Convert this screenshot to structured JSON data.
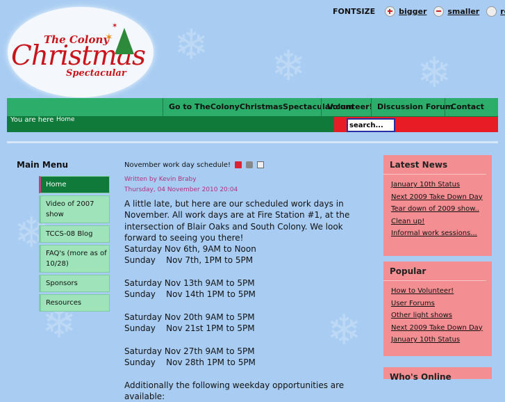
{
  "logo": {
    "line1": "The Colony",
    "line2": "Christmas",
    "line3": "Spectacular"
  },
  "fontsize": {
    "label": "FONTSIZE",
    "bigger": "bigger",
    "smaller": "smaller",
    "reset": "reset"
  },
  "topnav": {
    "items": [
      "Go to TheColonyChristmasSpectacular.com",
      "Volunteer!",
      "Discussion Forum",
      "Contact Us!"
    ]
  },
  "breadcrumb": {
    "label": "You are here",
    "home": "Home"
  },
  "search": {
    "placeholder": "search..."
  },
  "main_menu": {
    "title": "Main Menu",
    "items": [
      "Home",
      "Video of 2007 show",
      "TCCS-08 Blog",
      "FAQ's (more as of 10/28)",
      "Sponsors",
      "Resources"
    ]
  },
  "article": {
    "title": "November work day schedule!",
    "author": "Written by Kevin Braby",
    "date": "Thursday, 04 November 2010 20:04",
    "intro": "A little late, but here are our scheduled work days in November. All work days are at Fire Station #1, at the intersection of Blair Oaks and South Colony. We look forward to seeing you there!",
    "schedule": [
      [
        "Saturday Nov 6th, 9AM to Noon",
        "Sunday    Nov 7th, 1PM to 5PM"
      ],
      [
        "Saturday Nov 13th 9AM to 5PM",
        "Sunday    Nov 14th 1PM to 5PM"
      ],
      [
        "Saturday Nov 20th 9AM to 5PM",
        "Sunday    Nov 21st 1PM to 5PM"
      ],
      [
        "Saturday Nov 27th 9AM to 5PM",
        "Sunday    Nov 28th 1PM to 5PM"
      ]
    ],
    "closing": "Additionally the following weekday opportunities are available:"
  },
  "latest_news": {
    "title": "Latest News",
    "items": [
      "January 10th Status",
      "Next 2009 Take Down Day",
      "Tear down of 2009 show..",
      "Clean up!",
      "Informal work sessions..."
    ]
  },
  "popular": {
    "title": "Popular",
    "items": [
      "How to Volunteer!",
      "User Forums",
      "Other light shows",
      "Next 2009 Take Down Day",
      "January 10th Status"
    ]
  },
  "whos_online": {
    "title": "Who's Online"
  },
  "colors": {
    "background": "#a9cdf2",
    "nav_green": "#2cae6a",
    "dark_green": "#0f7a3a",
    "red_bar": "#e81c24",
    "module_pink": "#f38f92",
    "menu_mint": "#9ee3b9",
    "logo_red": "#c8141a"
  }
}
